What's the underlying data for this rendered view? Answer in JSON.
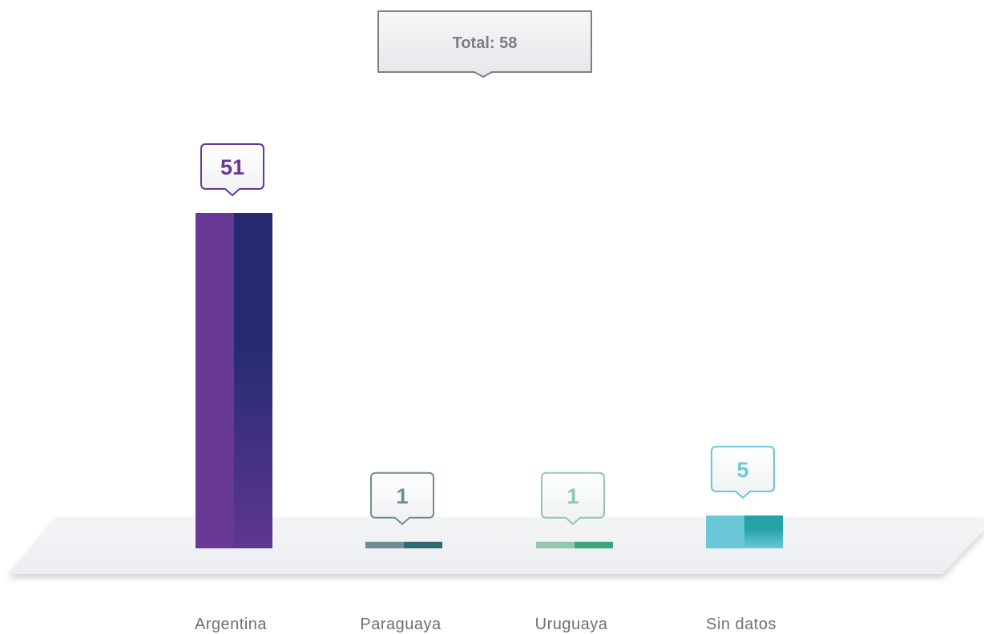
{
  "chart_data": {
    "type": "bar",
    "total_label": "Total: 58",
    "categories": [
      "Argentina",
      "Paraguaya",
      "Uruguaya",
      "Sin datos"
    ],
    "values": [
      51,
      1,
      1,
      5
    ],
    "value_labels": [
      "51",
      "1",
      "1",
      "5"
    ],
    "colors": [
      {
        "left": "#673894",
        "right": "#262b71",
        "right_bottom": "#5e3791",
        "stroke": "#673894",
        "text": "#673894"
      },
      {
        "left": "#6f8e94",
        "right": "#2f6c72",
        "right_bottom": "#2f6c72",
        "stroke": "#6f8e94",
        "text": "#6f8e94"
      },
      {
        "left": "#93c8ad",
        "right": "#3aa77c",
        "right_bottom": "#3aa77c",
        "stroke": "#93c8ad",
        "text": "#93c8ad"
      },
      {
        "left": "#6ac8d8",
        "right": "#26a2a6",
        "right_bottom": "#6ac8d8",
        "stroke": "#6ac8d8",
        "text": "#6ac8d8"
      }
    ],
    "ylim": [
      0,
      51
    ],
    "grid": false,
    "legend": "none"
  }
}
